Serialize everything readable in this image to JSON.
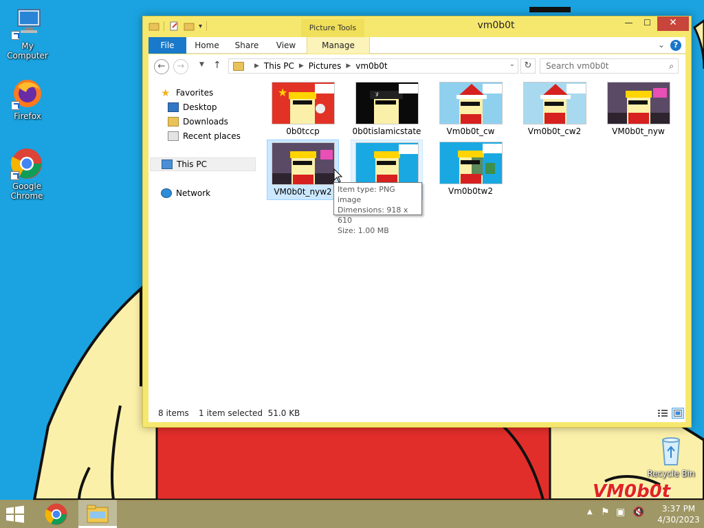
{
  "desktop": {
    "icons": [
      {
        "label": "My Computer",
        "icon": "computer-icon"
      },
      {
        "label": "Firefox",
        "icon": "firefox-icon"
      },
      {
        "label": "Google Chrome",
        "icon": "chrome-icon"
      },
      {
        "label": "Recycle Bin",
        "icon": "recycle-bin-icon"
      }
    ],
    "watermark": "VM0b0t"
  },
  "window": {
    "title": "vm0b0t",
    "context_tab": "Picture Tools",
    "controls": {
      "minimize": "—",
      "maximize": "☐",
      "close": "✕"
    },
    "ribbon_tabs": [
      "File",
      "Home",
      "Share",
      "View",
      "Manage"
    ],
    "help": "?",
    "address": {
      "crumbs": [
        "This PC",
        "Pictures",
        "vm0b0t"
      ]
    },
    "search_placeholder": "Search vm0b0t",
    "nav": {
      "favorites": "Favorites",
      "favorites_items": [
        "Desktop",
        "Downloads",
        "Recent places"
      ],
      "this_pc": "This PC",
      "network": "Network"
    },
    "files": [
      {
        "name": "0b0tccp",
        "state": "normal"
      },
      {
        "name": "0b0tislamicstate",
        "state": "normal"
      },
      {
        "name": "Vm0b0t_cw",
        "state": "normal"
      },
      {
        "name": "Vm0b0t_cw2",
        "state": "normal"
      },
      {
        "name": "VM0b0t_nyw",
        "state": "normal"
      },
      {
        "name": "VM0b0t_nyw2",
        "state": "selected"
      },
      {
        "name": "",
        "state": "hover"
      },
      {
        "name": "Vm0b0tw2",
        "state": "normal"
      }
    ],
    "tooltip": {
      "type": "Item type: PNG image",
      "dimensions": "Dimensions: 918 x 610",
      "size": "Size: 1.00 MB"
    },
    "status": {
      "count": "8 items",
      "selection": "1 item selected  51.0 KB"
    }
  },
  "taskbar": {
    "apps": [
      "chrome",
      "file-explorer"
    ],
    "time": "3:37 PM",
    "date": "4/30/2023"
  },
  "colors": {
    "window_frame": "#f6e86e",
    "file_tab": "#1979ca",
    "selected_item": "#cce8ff",
    "close_button": "#c7453a",
    "desktop_bg": "#1aa3e0"
  }
}
